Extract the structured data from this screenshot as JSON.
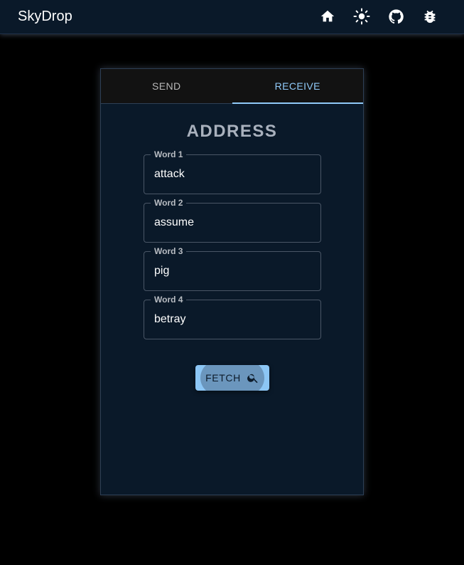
{
  "app": {
    "title": "SkyDrop",
    "icons": [
      "home-icon",
      "brightness-icon",
      "github-icon",
      "bug-icon"
    ]
  },
  "tabs": [
    {
      "label": "SEND",
      "active": false
    },
    {
      "label": "RECEIVE",
      "active": true
    }
  ],
  "main": {
    "heading": "ADDRESS",
    "fields": [
      {
        "label": "Word 1",
        "value": "attack"
      },
      {
        "label": "Word 2",
        "value": "assume"
      },
      {
        "label": "Word 3",
        "value": "pig"
      },
      {
        "label": "Word 4",
        "value": "betray"
      }
    ],
    "fetch_label": "FETCH",
    "fetch_icon": "search-icon"
  },
  "colors": {
    "appbar": "#0a1929",
    "accent": "#90caf9",
    "background": "#000000"
  }
}
